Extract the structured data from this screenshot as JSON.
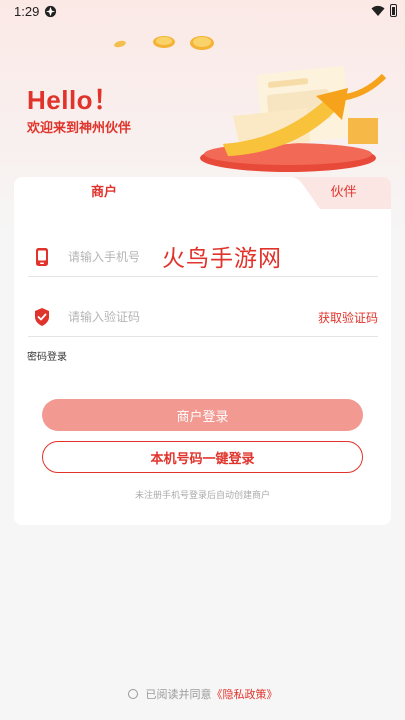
{
  "status_bar": {
    "time": "1:29"
  },
  "hero": {
    "title": "Hello！",
    "subtitle": "欢迎来到神州伙伴"
  },
  "tabs": [
    {
      "label": "商户",
      "active": true
    },
    {
      "label": "伙伴",
      "active": false
    }
  ],
  "form": {
    "phone_placeholder": "请输入手机号",
    "code_placeholder": "请输入验证码",
    "get_code_label": "获取验证码",
    "password_login_label": "密码登录"
  },
  "watermark_text": "火鸟手游网",
  "buttons": {
    "login_label": "商户登录",
    "onekey_label": "本机号码一键登录"
  },
  "hint": "未注册手机号登录后自动创建商户",
  "agreement": {
    "prefix": "已阅读并同意",
    "link": "《隐私政策》"
  },
  "colors": {
    "accent": "#e0332b",
    "button_disabled": "#f29a92",
    "tab_inactive_bg": "#fbe6e4"
  }
}
